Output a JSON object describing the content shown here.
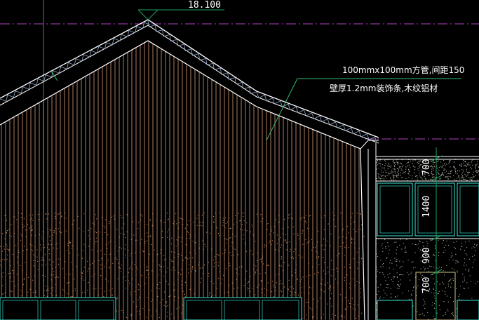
{
  "drawing": {
    "elevation_label": "18.100",
    "annotation_line1": "100mmx100mm方管,间距150",
    "annotation_line2": "壁厚1.2mm装饰条,木纹铝材",
    "dims": [
      "700",
      "1400",
      "900",
      "700"
    ]
  },
  "colors": {
    "background": "#000000",
    "roof_outline": "#ffffff",
    "roof_tiles": "#8fa8c8",
    "vertical_slats": "#d89a7a",
    "stucco_dots": "#c88a5a",
    "stucco_dots_right": "#b8b8a8",
    "guide_magenta": "#b040c0",
    "guide_green": "#20a060",
    "leader_green": "#30c070",
    "window_frame": "#30c0b0"
  }
}
